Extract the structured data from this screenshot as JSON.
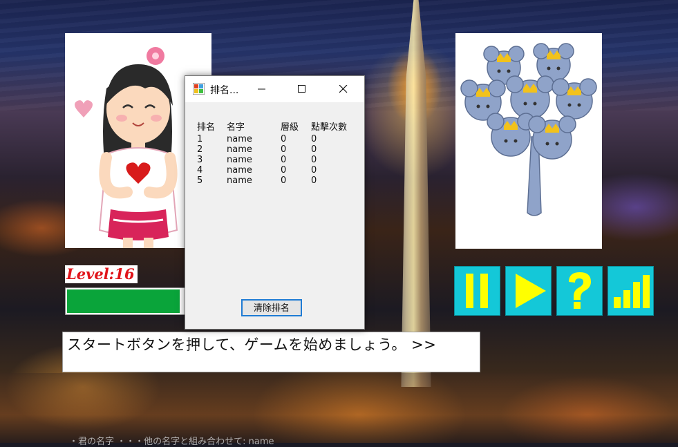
{
  "background": {
    "footer_text": "・君の名字 ・・・他の名字と組み合わせて: name"
  },
  "level": {
    "label": "Level:16",
    "progress": 0.96
  },
  "controls": {
    "pause_icon": "pause-icon",
    "play_icon": "play-icon",
    "help_icon": "question-icon",
    "ranking_icon": "bar-chart-icon",
    "button_color": "#14c8d8",
    "icon_color": "#ffff00"
  },
  "message": {
    "text": "スタートボタンを押して、ゲームを始めましょう。 >>"
  },
  "dialog": {
    "title": "排名...",
    "headers": [
      "排名",
      "名字",
      "層級",
      "點擊次數"
    ],
    "rows": [
      [
        "1",
        "name",
        "0",
        "0"
      ],
      [
        "2",
        "name",
        "0",
        "0"
      ],
      [
        "3",
        "name",
        "0",
        "0"
      ],
      [
        "4",
        "name",
        "0",
        "0"
      ],
      [
        "5",
        "name",
        "0",
        "0"
      ]
    ],
    "clear_button": "清除排名"
  },
  "colors": {
    "level_text": "#e0141a",
    "level_fill": "#0aa43a",
    "focus_border": "#1e7bd4"
  }
}
